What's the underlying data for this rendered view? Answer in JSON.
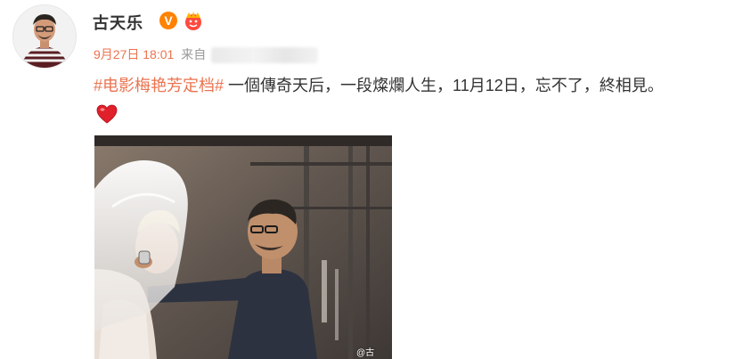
{
  "user": {
    "name": "古天乐",
    "verified_badge": "V",
    "badges": [
      "verified-icon",
      "vip-crown-icon"
    ]
  },
  "post": {
    "time": "9月27日 18:01",
    "source_label": "来自",
    "hashtag": "#电影梅艳芳定档#",
    "text": " 一個傳奇天后，一段燦爛人生，11月12日，忘不了，終相見。",
    "emoji": "heart-icon",
    "image_watermark": "@古"
  },
  "colors": {
    "accent": "#eb7350",
    "verified": "#ff8200",
    "heart": "#e0202b",
    "meta_gray": "#999999"
  }
}
